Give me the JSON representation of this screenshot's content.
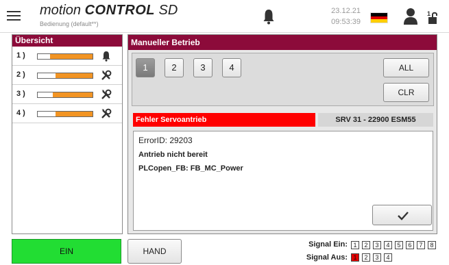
{
  "header": {
    "title_italic": "motion ",
    "title_bold": "CONTROL",
    "title_suffix": " SD",
    "subtitle": "Bedienung (default**)",
    "date": "23.12.21",
    "time": "09:53:39",
    "lock_level": "1",
    "flag_colors": [
      "#000000",
      "#dd0000",
      "#ffce00"
    ],
    "icons": [
      "menu-icon",
      "bell-icon",
      "flag-icon",
      "user-icon",
      "unlock-icon"
    ]
  },
  "overview": {
    "title": "Übersicht",
    "axes": [
      {
        "label": "1 )",
        "level": 0.78,
        "icon": "bell-icon"
      },
      {
        "label": "2 )",
        "level": 0.68,
        "icon": "tools-icon"
      },
      {
        "label": "3 )",
        "level": 0.72,
        "icon": "tools-icon"
      },
      {
        "label": "4 )",
        "level": 0.68,
        "icon": "tools-icon"
      }
    ]
  },
  "manual": {
    "title": "Manueller Betrieb",
    "axis_buttons": [
      "1",
      "2",
      "3",
      "4"
    ],
    "active_axis": "1",
    "all_label": "ALL",
    "clr_label": "CLR",
    "error_title": "Fehler Servoantrieb",
    "drive_label": "SRV 31 - 22900 ESM55",
    "error_id": "ErrorID: 29203",
    "error_text": "Antrieb nicht bereit",
    "error_fb": "PLCopen_FB: FB_MC_Power",
    "ack_icon": "check-icon"
  },
  "bottom": {
    "ein_label": "EIN",
    "hand_label": "HAND",
    "signal_in_label": "Signal Ein:",
    "signal_out_label": "Signal Aus:",
    "signal_in": [
      "1",
      "2",
      "3",
      "4",
      "5",
      "6",
      "7",
      "8"
    ],
    "signal_out": [
      "1",
      "2",
      "3",
      "4"
    ],
    "signal_out_active": "1",
    "colors": {
      "ein": "#22dd33",
      "error": "#ff0000",
      "accent": "#8c0b3a",
      "bar": "#f29423"
    }
  }
}
